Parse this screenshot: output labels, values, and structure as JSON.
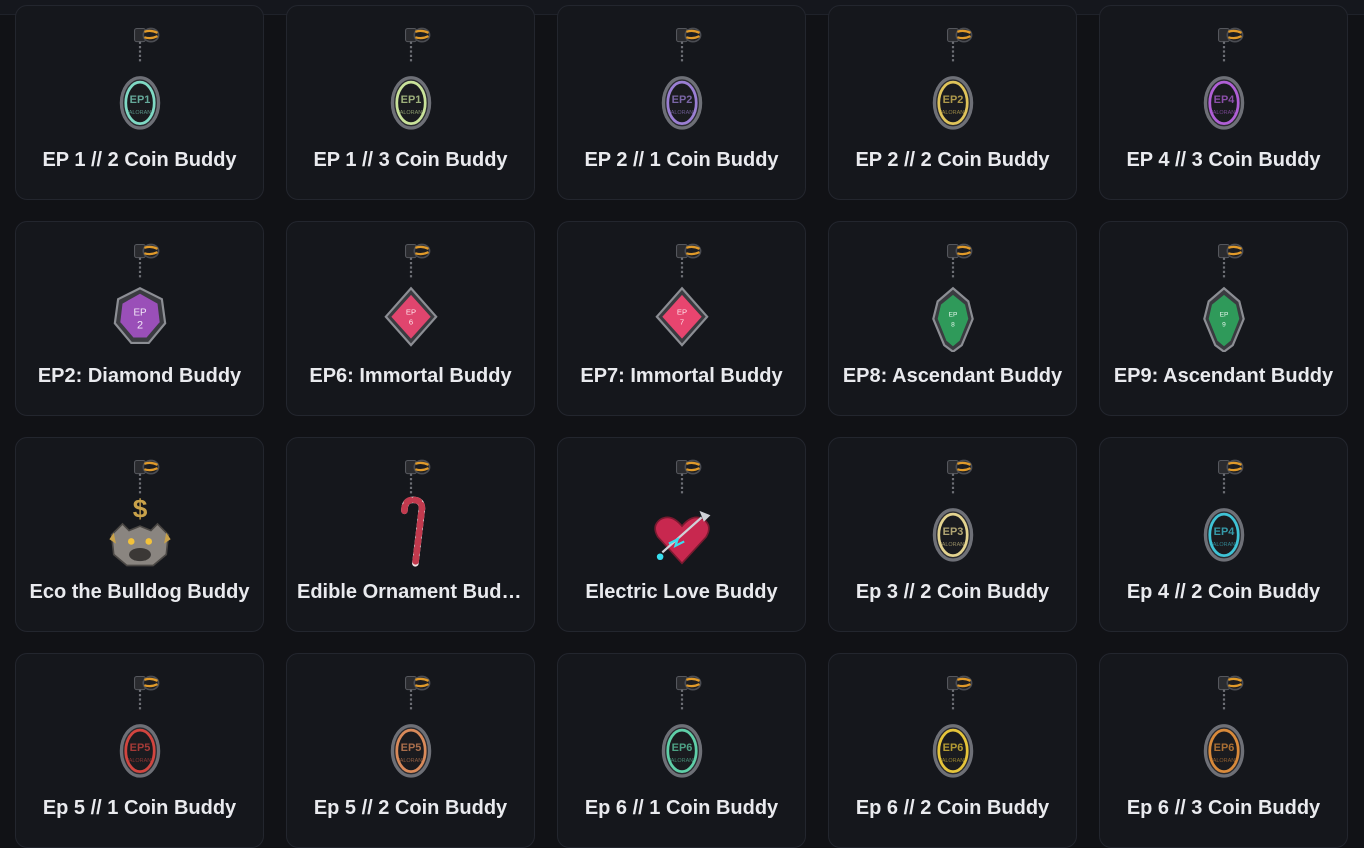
{
  "items": [
    {
      "name": "EP 1 // 2 Coin Buddy",
      "icon": "coin-buddy-icon",
      "shape": "coin",
      "color": "#7fd9c4",
      "glyph": "EP1"
    },
    {
      "name": "EP 1 // 3 Coin Buddy",
      "icon": "coin-buddy-icon",
      "shape": "coin",
      "color": "#c9e29a",
      "glyph": "EP1"
    },
    {
      "name": "EP 2 // 1 Coin Buddy",
      "icon": "coin-buddy-icon",
      "shape": "coin",
      "color": "#9b7fd4",
      "glyph": "EP2"
    },
    {
      "name": "EP 2 // 2 Coin Buddy",
      "icon": "coin-buddy-icon",
      "shape": "coin",
      "color": "#e0c45a",
      "glyph": "EP2"
    },
    {
      "name": "EP 4 // 3 Coin Buddy",
      "icon": "coin-buddy-icon",
      "shape": "coin",
      "color": "#b05fd6",
      "glyph": "EP4"
    },
    {
      "name": "EP2: Diamond Buddy",
      "icon": "diamond-rank-buddy-icon",
      "shape": "hex",
      "color": "#9a4fb8",
      "glyph": "EP 2"
    },
    {
      "name": "EP6: Immortal Buddy",
      "icon": "immortal-rank-buddy-icon",
      "shape": "diamond",
      "color": "#e0456e",
      "glyph": "EP 6"
    },
    {
      "name": "EP7: Immortal Buddy",
      "icon": "immortal-rank-buddy-icon",
      "shape": "diamond",
      "color": "#e8456f",
      "glyph": "EP 7"
    },
    {
      "name": "EP8: Ascendant Buddy",
      "icon": "ascendant-rank-buddy-icon",
      "shape": "gem",
      "color": "#2f9a5a",
      "glyph": "EP 8"
    },
    {
      "name": "EP9: Ascendant Buddy",
      "icon": "ascendant-rank-buddy-icon",
      "shape": "gem",
      "color": "#2f9a5a",
      "glyph": "EP 9"
    },
    {
      "name": "Eco the Bulldog Buddy",
      "icon": "bulldog-buddy-icon",
      "shape": "bulldog",
      "color": "#c9a24a",
      "glyph": "$"
    },
    {
      "name": "Edible Ornament Buddy",
      "icon": "candy-cane-buddy-icon",
      "shape": "cane",
      "color": "#c23a4e",
      "glyph": ""
    },
    {
      "name": "Electric Love Buddy",
      "icon": "heart-buddy-icon",
      "shape": "heart",
      "color": "#c8284f",
      "glyph": ""
    },
    {
      "name": "Ep 3 // 2 Coin Buddy",
      "icon": "coin-buddy-icon",
      "shape": "coin",
      "color": "#e3d38f",
      "glyph": "EP3"
    },
    {
      "name": "Ep 4 // 2 Coin Buddy",
      "icon": "coin-buddy-icon",
      "shape": "coin",
      "color": "#3fc3d6",
      "glyph": "EP4"
    },
    {
      "name": "Ep 5 // 1 Coin Buddy",
      "icon": "coin-buddy-icon",
      "shape": "coin",
      "color": "#d2453f",
      "glyph": "EP5"
    },
    {
      "name": "Ep 5 // 2 Coin Buddy",
      "icon": "coin-buddy-icon",
      "shape": "coin",
      "color": "#d98a5a",
      "glyph": "EP5"
    },
    {
      "name": "Ep 6 // 1 Coin Buddy",
      "icon": "coin-buddy-icon",
      "shape": "coin",
      "color": "#5fcfa8",
      "glyph": "EP6"
    },
    {
      "name": "Ep 6 // 2 Coin Buddy",
      "icon": "coin-buddy-icon",
      "shape": "coin",
      "color": "#e6c53a",
      "glyph": "EP6"
    },
    {
      "name": "Ep 6 // 3 Coin Buddy",
      "icon": "coin-buddy-icon",
      "shape": "coin",
      "color": "#d98a3a",
      "glyph": "EP6"
    }
  ]
}
